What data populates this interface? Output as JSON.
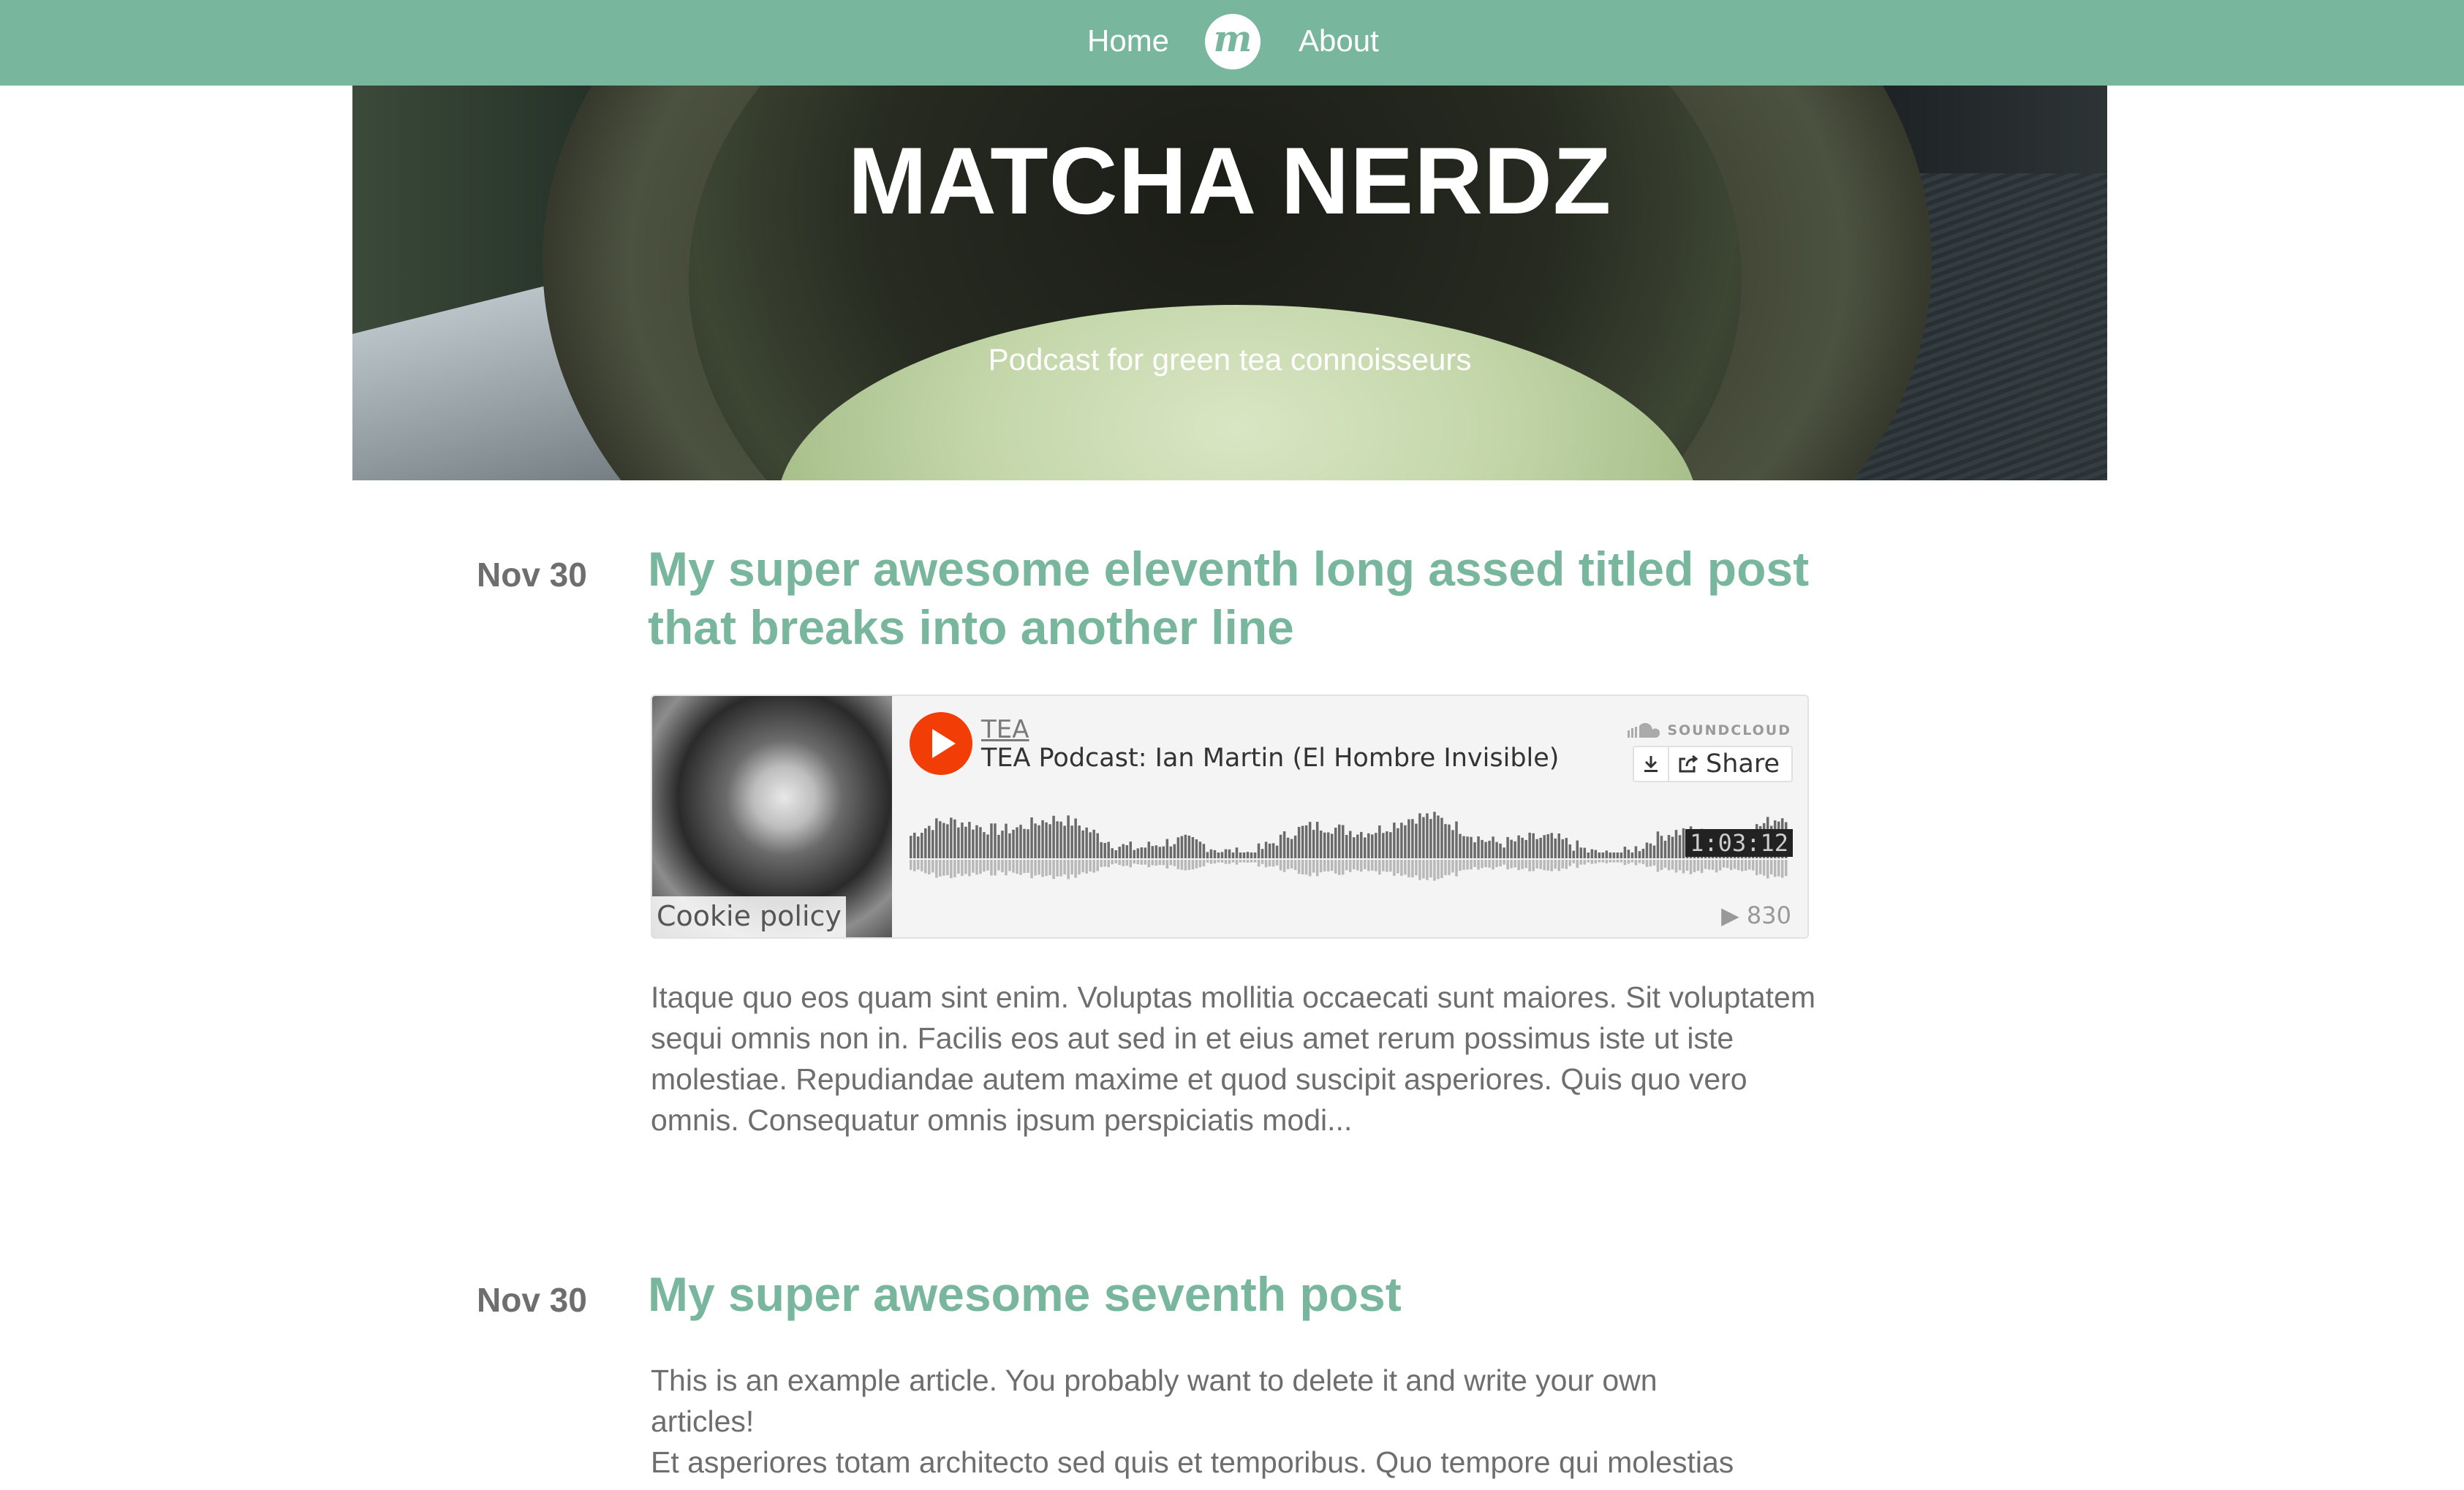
{
  "nav": {
    "home_label": "Home",
    "logo_glyph": "m",
    "about_label": "About"
  },
  "hero": {
    "title": "MATCHA NERDZ",
    "subtitle": "Podcast for green tea connoisseurs"
  },
  "posts": [
    {
      "date": "Nov 30",
      "title": "My super awesome eleventh long assed titled post that breaks into another line",
      "embed": {
        "artist": "TEA",
        "track": "TEA Podcast: Ian Martin (El Hombre Invisible)",
        "brand": "SOUNDCLOUD",
        "share_label": "Share",
        "duration": "1:03:12",
        "plays": "▶ 830",
        "cookie_label": "Cookie policy",
        "play_color": "#f23d06"
      },
      "excerpt": "Itaque quo eos quam sint enim. Voluptas mollitia occaecati sunt maiores. Sit voluptatem sequi omnis non in. Facilis eos aut sed in et eius amet rerum possimus iste ut iste molestiae. Repudiandae autem maxime et quod suscipit asperiores. Quis quo vero omnis. Consequatur omnis ipsum perspiciatis modi..."
    },
    {
      "date": "Nov 30",
      "title": "My super awesome seventh post",
      "excerpt_line1": "This is an example article. You probably want to delete it and write your own articles!",
      "excerpt_line2": "Et asperiores totam architecto sed quis et temporibus. Quo tempore qui molestias"
    }
  ],
  "colors": {
    "accent": "#78b79d",
    "text": "#6e6e6e",
    "soundcloud_orange": "#f23d06"
  }
}
